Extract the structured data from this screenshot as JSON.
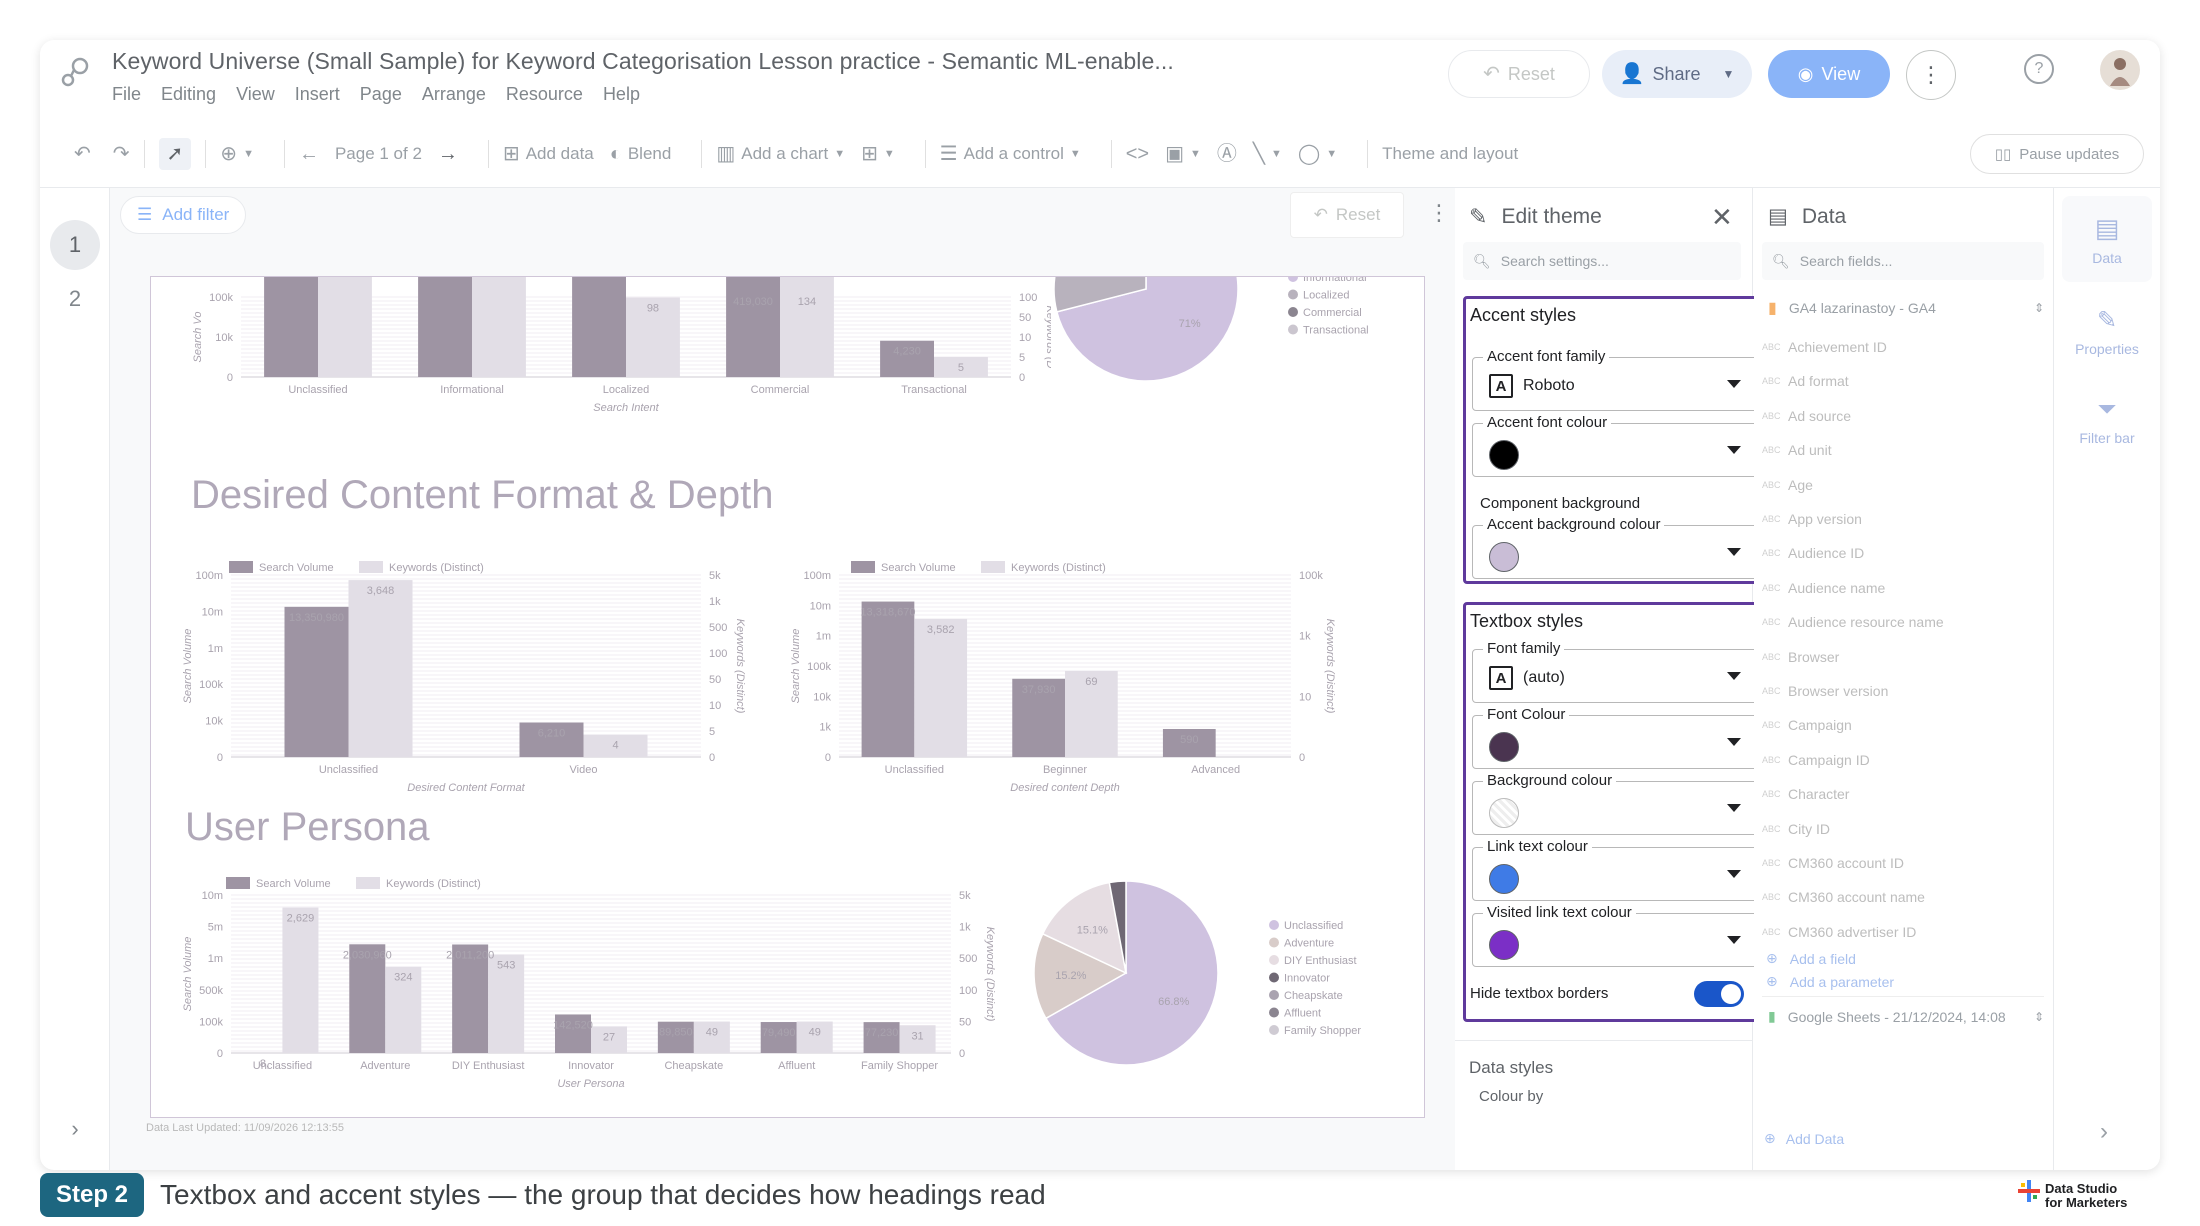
{
  "header": {
    "title": "Keyword Universe (Small Sample) for Keyword Categorisation Lesson practice - Semantic ML-enable...",
    "menu": [
      "File",
      "Editing",
      "View",
      "Insert",
      "Page",
      "Arrange",
      "Resource",
      "Help"
    ],
    "reset_label": "Reset",
    "share_label": "Share",
    "view_label": "View"
  },
  "toolbar": {
    "page_label": "Page 1 of 2",
    "add_data": "Add data",
    "blend": "Blend",
    "add_chart": "Add a chart",
    "add_control": "Add a control",
    "theme_layout": "Theme and layout",
    "pause_updates": "Pause updates"
  },
  "pages": [
    "1",
    "2"
  ],
  "canvas": {
    "add_filter": "Add filter",
    "reset": "Reset",
    "footer_note": "Data Last Updated: 11/09/2026 12:13:55",
    "sections": {
      "format_depth": "Desired Content Format & Depth",
      "persona": "User Persona"
    },
    "legend": {
      "sv": "Search Volume",
      "kw": "Keywords (Distinct)"
    },
    "pie_legend_top": [
      "Informational",
      "Localized",
      "Commercial",
      "Transactional"
    ],
    "pie_legend_persona": [
      "Unclassified",
      "Adventure",
      "DIY Enthusiast",
      "Innovator",
      "Cheapskate",
      "Affluent",
      "Family Shopper"
    ]
  },
  "chart_data": [
    {
      "type": "bar",
      "title": "",
      "xlabel": "Search Intent",
      "ylabel": "Search Vo",
      "y2label": "Keywords (D",
      "categories": [
        "Unclassified",
        "Informational",
        "Localized",
        "Commercial",
        "Transactional"
      ],
      "y_ticks": [
        "100k",
        "10k",
        "0"
      ],
      "y2_ticks": [
        "100",
        "50",
        "10",
        "5",
        "0"
      ],
      "series": [
        {
          "name": "Search Volume",
          "values": [
            null,
            null,
            null,
            419030,
            4230
          ],
          "labels": [
            "",
            "",
            "",
            "419,030",
            "4,230"
          ]
        },
        {
          "name": "Keywords (Distinct)",
          "values": [
            null,
            null,
            98,
            134,
            5
          ],
          "labels": [
            "",
            "",
            "98",
            "134",
            "5"
          ]
        }
      ]
    },
    {
      "type": "pie",
      "title": "",
      "labels": [
        "Informational",
        "Localized",
        "Commercial",
        "Transactional"
      ],
      "values": [
        71
      ],
      "value_labels": [
        "71%"
      ]
    },
    {
      "type": "bar",
      "title": "",
      "xlabel": "Desired Content Format",
      "ylabel": "Search Volume",
      "y2label": "Keywords (Distinct)",
      "categories": [
        "Unclassified",
        "Video"
      ],
      "y_ticks": [
        "100m",
        "10m",
        "1m",
        "100k",
        "10k",
        "0"
      ],
      "y2_ticks": [
        "5k",
        "1k",
        "500",
        "100",
        "50",
        "10",
        "5",
        "0"
      ],
      "series": [
        {
          "name": "Search Volume",
          "values": [
            13350980,
            6210
          ],
          "labels": [
            "13,350,980",
            "6,210"
          ]
        },
        {
          "name": "Keywords (Distinct)",
          "values": [
            3648,
            4
          ],
          "labels": [
            "3,648",
            "4"
          ]
        }
      ]
    },
    {
      "type": "bar",
      "title": "",
      "xlabel": "Desired content Depth",
      "ylabel": "Search Volume",
      "y2label": "Keywords (Distinct)",
      "categories": [
        "Unclassified",
        "Beginner",
        "Advanced"
      ],
      "y_ticks": [
        "100m",
        "10m",
        "1m",
        "100k",
        "10k",
        "1k",
        "0"
      ],
      "y2_ticks": [
        "100k",
        "1k",
        "10",
        "0"
      ],
      "series": [
        {
          "name": "Search Volume",
          "values": [
            13318670,
            37930,
            590
          ],
          "labels": [
            "13,318,670",
            "37,930",
            "590"
          ]
        },
        {
          "name": "Keywords (Distinct)",
          "values": [
            3582,
            69,
            null
          ],
          "labels": [
            "3,582",
            "69",
            ""
          ]
        }
      ]
    },
    {
      "type": "bar",
      "title": "",
      "xlabel": "User Persona",
      "ylabel": "Search Volume",
      "y2label": "Keywords (Distinct)",
      "categories": [
        "Unclassified",
        "Adventure",
        "DIY Enthusiast",
        "Innovator",
        "Cheapskate",
        "Affluent",
        "Family Shopper"
      ],
      "y_ticks": [
        "10m",
        "5m",
        "1m",
        "500k",
        "100k",
        "0"
      ],
      "y2_ticks": [
        "5k",
        "1k",
        "500",
        "100",
        "50",
        "0"
      ],
      "series": [
        {
          "name": "Search Volume",
          "values": [
            null,
            2030960,
            2011200,
            142520,
            89850,
            79490,
            77230
          ],
          "labels": [
            "8,",
            "2,030,960",
            "2,011,200",
            "142,520",
            "89,850",
            "79,490",
            "77,230"
          ]
        },
        {
          "name": "Keywords (Distinct)",
          "values": [
            2629,
            324,
            543,
            27,
            49,
            49,
            31
          ],
          "labels": [
            "2,629",
            "324",
            "543",
            "27",
            "49",
            "49",
            "31"
          ]
        }
      ]
    },
    {
      "type": "pie",
      "title": "",
      "labels": [
        "Unclassified",
        "Adventure",
        "DIY Enthusiast",
        "Innovator",
        "Cheapskate",
        "Affluent",
        "Family Shopper"
      ],
      "values": [
        66.8,
        15.2,
        15.1
      ],
      "value_labels": [
        "66.8%",
        "15.2%",
        "15.1%"
      ]
    }
  ],
  "theme_panel": {
    "title": "Edit theme",
    "search_placeholder": "Search settings...",
    "accent": {
      "title": "Accent styles",
      "font_family_label": "Accent font family",
      "font_family_value": "Roboto",
      "font_colour_label": "Accent font colour",
      "font_colour": "#000000",
      "component_bg": "Component background",
      "bg_colour_label": "Accent background colour",
      "bg_colour": "#c9bdd6"
    },
    "textbox": {
      "title": "Textbox styles",
      "font_family_label": "Font family",
      "font_family_value": "(auto)",
      "font_colour_label": "Font Colour",
      "font_colour": "#4a3450",
      "bg_label": "Background colour",
      "link_label": "Link text colour",
      "link_colour": "#3f7be6",
      "visited_label": "Visited link text colour",
      "visited_colour": "#7b2fc6",
      "hide_borders": "Hide textbox borders",
      "toggle_on": true
    },
    "data_styles": "Data styles",
    "colour_by": "Colour by"
  },
  "data_panel": {
    "title": "Data",
    "search_placeholder": "Search fields...",
    "source": "GA4 lazarinastoy - GA4",
    "fields": [
      "Achievement ID",
      "Ad format",
      "Ad source",
      "Ad unit",
      "Age",
      "App version",
      "Audience ID",
      "Audience name",
      "Audience resource name",
      "Browser",
      "Browser version",
      "Campaign",
      "Campaign ID",
      "Character",
      "City ID",
      "CM360 account ID",
      "CM360 account name",
      "CM360 advertiser ID"
    ],
    "add_field": "Add a field",
    "add_parameter": "Add a parameter",
    "sheet_source": "Google Sheets - 21/12/2024, 14:08",
    "add_data": "Add Data"
  },
  "right_rail": {
    "data": "Data",
    "properties": "Properties",
    "filter_bar": "Filter bar"
  },
  "caption": {
    "step": "Step 2",
    "text": "Textbox and accent styles — the group that decides how headings read",
    "brand_line1": "Data Studio",
    "brand_line2": "for Marketers"
  },
  "colors": {
    "accent_box": "#5f3a9c",
    "bar_dark": "#9e94a3",
    "bar_light": "#e2dee6",
    "step_bg": "#1d6680",
    "view_btn": "#8ab4f8"
  }
}
